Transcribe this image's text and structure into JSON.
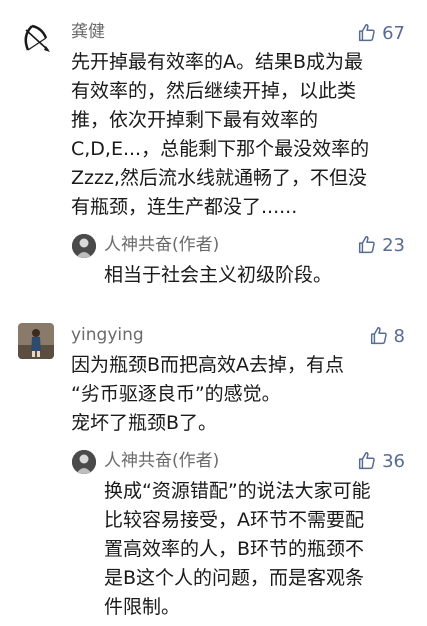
{
  "comments": [
    {
      "author": "龚健",
      "likes": "67",
      "lines": [
        "先开掉最有效率的A。结果B成为最",
        "有效率的，然后继续开掉，以此类",
        "推，依次开掉剩下最有效率的",
        "C,D,E...，总能剩下那个最没效率的",
        "Zzzz,然后流水线就通畅了，不但没",
        "有瓶颈，连生产都没了......"
      ],
      "reply": {
        "author": "人神共奋(作者)",
        "likes": "23",
        "lines": [
          "相当于社会主义初级阶段。"
        ]
      }
    },
    {
      "author": "yingying",
      "likes": "8",
      "lines": [
        "因为瓶颈B而把高效A去掉，有点",
        "“劣币驱逐良币”的感觉。",
        "宠坏了瓶颈B了。"
      ],
      "reply": {
        "author": "人神共奋(作者)",
        "likes": "36",
        "lines": [
          "换成“资源错配”的说法大家可能",
          "比较容易接受，A环节不需要配",
          "置高效率的人，B环节的瓶颈不",
          "是B这个人的问题，而是客观条",
          "件限制。"
        ]
      }
    }
  ]
}
